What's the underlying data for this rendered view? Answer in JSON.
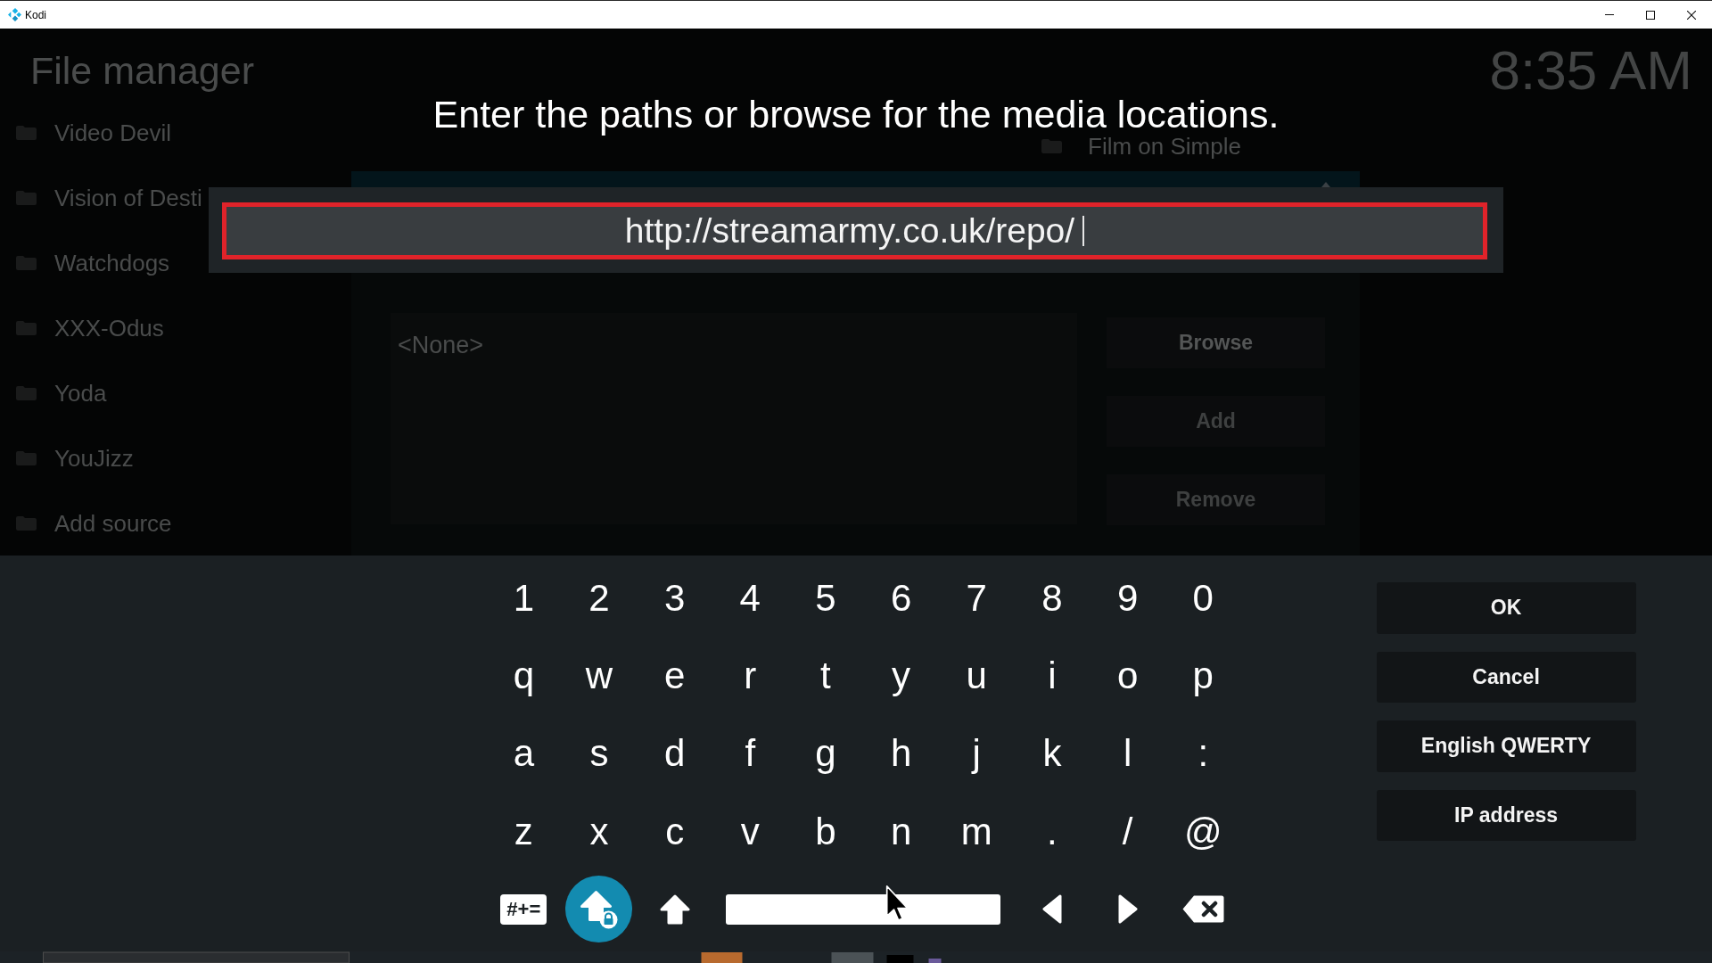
{
  "window": {
    "title": "Kodi"
  },
  "file_manager": {
    "title": "File manager",
    "clock": "8:35 AM",
    "sources": [
      "Video Devil",
      "Vision of Desti",
      "Watchdogs",
      "XXX-Odus",
      "Yoda",
      "YouJizz",
      "Add source"
    ],
    "second_column_item": "Film on Simple",
    "source_dialog": {
      "paths": [
        "<None>"
      ],
      "buttons": [
        {
          "label": "Browse",
          "disabled": false
        },
        {
          "label": "Add",
          "disabled": true
        },
        {
          "label": "Remove",
          "disabled": true
        }
      ]
    }
  },
  "keyboard": {
    "heading": "Enter the paths or browse for the media locations.",
    "input": {
      "value": "http://streamarmy.co.uk/repo/",
      "focused": true
    },
    "key_rows": [
      [
        "1",
        "2",
        "3",
        "4",
        "5",
        "6",
        "7",
        "8",
        "9",
        "0"
      ],
      [
        "q",
        "w",
        "e",
        "r",
        "t",
        "y",
        "u",
        "i",
        "o",
        "p"
      ],
      [
        "a",
        "s",
        "d",
        "f",
        "g",
        "h",
        "j",
        "k",
        "l",
        ":"
      ],
      [
        "z",
        "x",
        "c",
        "v",
        "b",
        "n",
        "m",
        ".",
        "/",
        "@"
      ]
    ],
    "bottom_keys": [
      {
        "kind": "symbols",
        "label": "#+=",
        "focused": false
      },
      {
        "kind": "caps_lock",
        "focused": true
      },
      {
        "kind": "shift",
        "focused": false
      },
      {
        "kind": "space",
        "focused": false
      },
      {
        "kind": "left",
        "focused": false
      },
      {
        "kind": "right",
        "focused": false
      },
      {
        "kind": "backspace",
        "focused": false
      }
    ],
    "side_buttons": [
      {
        "label": "OK"
      },
      {
        "label": "Cancel"
      },
      {
        "label": "English QWERTY"
      },
      {
        "label": "IP address"
      }
    ]
  }
}
